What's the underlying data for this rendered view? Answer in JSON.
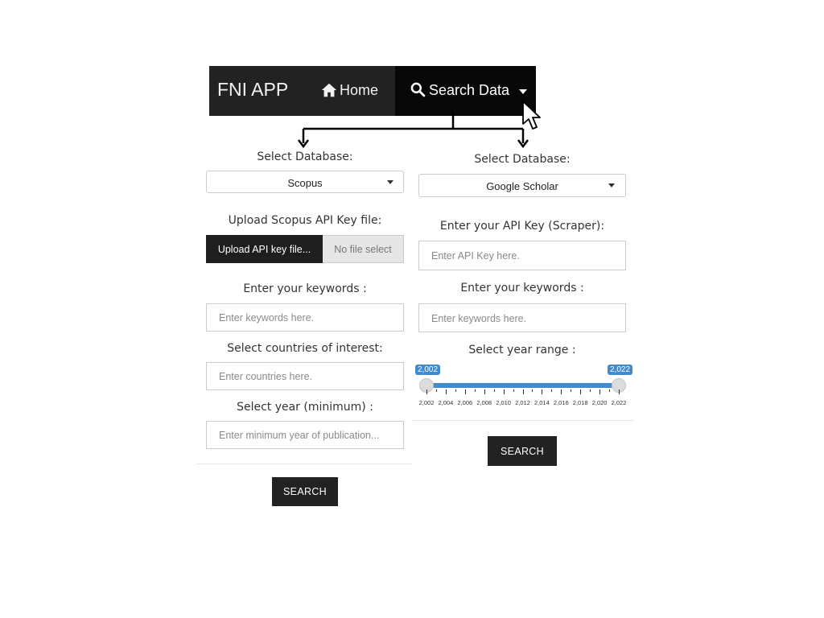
{
  "navbar": {
    "brand": "FNI APP",
    "home_label": "Home",
    "search_label": "Search Data"
  },
  "left_form": {
    "db_label": "Select Database:",
    "db_value": "Scopus",
    "upload_label": "Upload Scopus API Key file:",
    "upload_button": "Upload API key file...",
    "upload_status": "No file select",
    "keywords_label": "Enter your keywords :",
    "keywords_placeholder": "Enter keywords here.",
    "countries_label": "Select countries of interest:",
    "countries_placeholder": "Enter countries here.",
    "year_label": "Select year (minimum) :",
    "year_placeholder": "Enter minimum year of publication...",
    "search_button": "SEARCH"
  },
  "right_form": {
    "db_label": "Select Database:",
    "db_value": "Google Scholar",
    "api_label": "Enter your API Key (Scraper):",
    "api_placeholder": "Enter API Key here.",
    "keywords_label": "Enter your keywords :",
    "keywords_placeholder": "Enter keywords here.",
    "year_range_label": "Select year range :",
    "year_range": {
      "min_label": "2,002",
      "max_label": "2,022",
      "from": 2002,
      "to": 2022,
      "ticks": [
        "2,002",
        "2,004",
        "2,006",
        "2,008",
        "2,010",
        "2,012",
        "2,014",
        "2,016",
        "2,018",
        "2,020",
        "2,022"
      ]
    },
    "search_button": "SEARCH"
  },
  "colors": {
    "navbar_bg": "#222222",
    "nav_active_bg": "#080808",
    "button_bg": "#222222",
    "slider_accent": "#428bca"
  },
  "icons": [
    "home-icon",
    "search-icon",
    "caret-down-icon",
    "mouse-pointer-icon"
  ]
}
